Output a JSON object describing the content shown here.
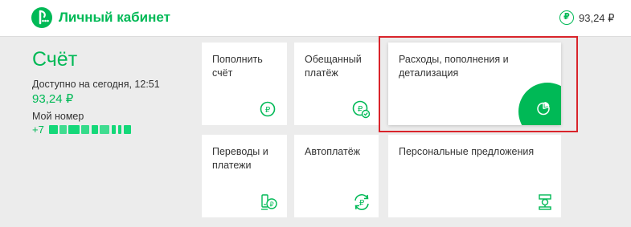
{
  "header": {
    "brand_title": "Личный кабинет",
    "balance": "93,24 ₽",
    "currency_symbol": "₽"
  },
  "account": {
    "title": "Счёт",
    "available_label": "Доступно на сегодня, 12:51",
    "available_value": "93,24 ₽",
    "number_label": "Мой номер",
    "phone_prefix": "+7"
  },
  "tiles": [
    {
      "label": "Пополнить счёт",
      "icon": "ruble-coin-icon"
    },
    {
      "label": "Обещанный платёж",
      "icon": "promised-payment-icon"
    },
    {
      "label": "Расходы, пополнения и детализация",
      "icon": "pie-chart-icon",
      "highlighted": true
    },
    {
      "label": "Переводы и платежи",
      "icon": "transfer-payments-icon"
    },
    {
      "label": "Автоплатёж",
      "icon": "autopay-icon"
    },
    {
      "label": "Персональные предложения",
      "icon": "trophy-offers-icon"
    }
  ],
  "colors": {
    "brand_green": "#00b956",
    "highlight_red": "#d9242b",
    "background": "#ececec",
    "text": "#333333"
  }
}
